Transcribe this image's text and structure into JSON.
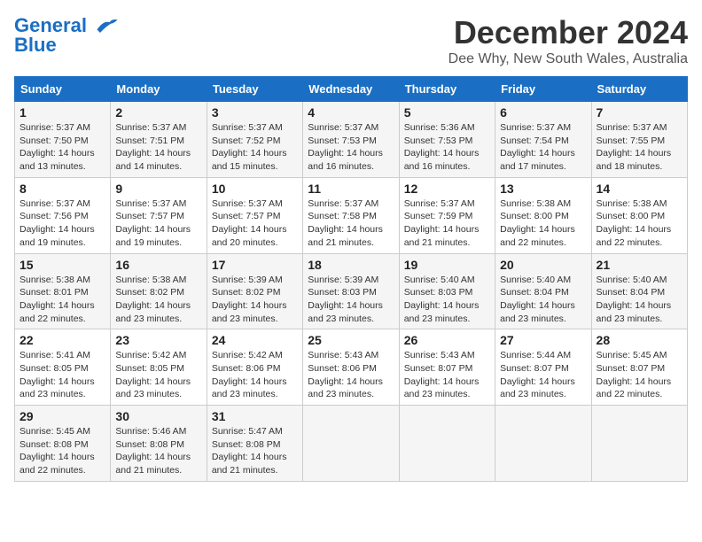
{
  "header": {
    "logo_line1": "General",
    "logo_line2": "Blue",
    "month_title": "December 2024",
    "location": "Dee Why, New South Wales, Australia"
  },
  "calendar": {
    "days_of_week": [
      "Sunday",
      "Monday",
      "Tuesday",
      "Wednesday",
      "Thursday",
      "Friday",
      "Saturday"
    ],
    "weeks": [
      [
        {
          "day": "1",
          "sunrise": "5:37 AM",
          "sunset": "7:50 PM",
          "daylight": "14 hours and 13 minutes."
        },
        {
          "day": "2",
          "sunrise": "5:37 AM",
          "sunset": "7:51 PM",
          "daylight": "14 hours and 14 minutes."
        },
        {
          "day": "3",
          "sunrise": "5:37 AM",
          "sunset": "7:52 PM",
          "daylight": "14 hours and 15 minutes."
        },
        {
          "day": "4",
          "sunrise": "5:37 AM",
          "sunset": "7:53 PM",
          "daylight": "14 hours and 16 minutes."
        },
        {
          "day": "5",
          "sunrise": "5:36 AM",
          "sunset": "7:53 PM",
          "daylight": "14 hours and 16 minutes."
        },
        {
          "day": "6",
          "sunrise": "5:37 AM",
          "sunset": "7:54 PM",
          "daylight": "14 hours and 17 minutes."
        },
        {
          "day": "7",
          "sunrise": "5:37 AM",
          "sunset": "7:55 PM",
          "daylight": "14 hours and 18 minutes."
        }
      ],
      [
        {
          "day": "8",
          "sunrise": "5:37 AM",
          "sunset": "7:56 PM",
          "daylight": "14 hours and 19 minutes."
        },
        {
          "day": "9",
          "sunrise": "5:37 AM",
          "sunset": "7:57 PM",
          "daylight": "14 hours and 19 minutes."
        },
        {
          "day": "10",
          "sunrise": "5:37 AM",
          "sunset": "7:57 PM",
          "daylight": "14 hours and 20 minutes."
        },
        {
          "day": "11",
          "sunrise": "5:37 AM",
          "sunset": "7:58 PM",
          "daylight": "14 hours and 21 minutes."
        },
        {
          "day": "12",
          "sunrise": "5:37 AM",
          "sunset": "7:59 PM",
          "daylight": "14 hours and 21 minutes."
        },
        {
          "day": "13",
          "sunrise": "5:38 AM",
          "sunset": "8:00 PM",
          "daylight": "14 hours and 22 minutes."
        },
        {
          "day": "14",
          "sunrise": "5:38 AM",
          "sunset": "8:00 PM",
          "daylight": "14 hours and 22 minutes."
        }
      ],
      [
        {
          "day": "15",
          "sunrise": "5:38 AM",
          "sunset": "8:01 PM",
          "daylight": "14 hours and 22 minutes."
        },
        {
          "day": "16",
          "sunrise": "5:38 AM",
          "sunset": "8:02 PM",
          "daylight": "14 hours and 23 minutes."
        },
        {
          "day": "17",
          "sunrise": "5:39 AM",
          "sunset": "8:02 PM",
          "daylight": "14 hours and 23 minutes."
        },
        {
          "day": "18",
          "sunrise": "5:39 AM",
          "sunset": "8:03 PM",
          "daylight": "14 hours and 23 minutes."
        },
        {
          "day": "19",
          "sunrise": "5:40 AM",
          "sunset": "8:03 PM",
          "daylight": "14 hours and 23 minutes."
        },
        {
          "day": "20",
          "sunrise": "5:40 AM",
          "sunset": "8:04 PM",
          "daylight": "14 hours and 23 minutes."
        },
        {
          "day": "21",
          "sunrise": "5:40 AM",
          "sunset": "8:04 PM",
          "daylight": "14 hours and 23 minutes."
        }
      ],
      [
        {
          "day": "22",
          "sunrise": "5:41 AM",
          "sunset": "8:05 PM",
          "daylight": "14 hours and 23 minutes."
        },
        {
          "day": "23",
          "sunrise": "5:42 AM",
          "sunset": "8:05 PM",
          "daylight": "14 hours and 23 minutes."
        },
        {
          "day": "24",
          "sunrise": "5:42 AM",
          "sunset": "8:06 PM",
          "daylight": "14 hours and 23 minutes."
        },
        {
          "day": "25",
          "sunrise": "5:43 AM",
          "sunset": "8:06 PM",
          "daylight": "14 hours and 23 minutes."
        },
        {
          "day": "26",
          "sunrise": "5:43 AM",
          "sunset": "8:07 PM",
          "daylight": "14 hours and 23 minutes."
        },
        {
          "day": "27",
          "sunrise": "5:44 AM",
          "sunset": "8:07 PM",
          "daylight": "14 hours and 23 minutes."
        },
        {
          "day": "28",
          "sunrise": "5:45 AM",
          "sunset": "8:07 PM",
          "daylight": "14 hours and 22 minutes."
        }
      ],
      [
        {
          "day": "29",
          "sunrise": "5:45 AM",
          "sunset": "8:08 PM",
          "daylight": "14 hours and 22 minutes."
        },
        {
          "day": "30",
          "sunrise": "5:46 AM",
          "sunset": "8:08 PM",
          "daylight": "14 hours and 21 minutes."
        },
        {
          "day": "31",
          "sunrise": "5:47 AM",
          "sunset": "8:08 PM",
          "daylight": "14 hours and 21 minutes."
        },
        null,
        null,
        null,
        null
      ]
    ]
  },
  "labels": {
    "sunrise_prefix": "Sunrise: ",
    "sunset_prefix": "Sunset: ",
    "daylight_prefix": "Daylight: "
  }
}
